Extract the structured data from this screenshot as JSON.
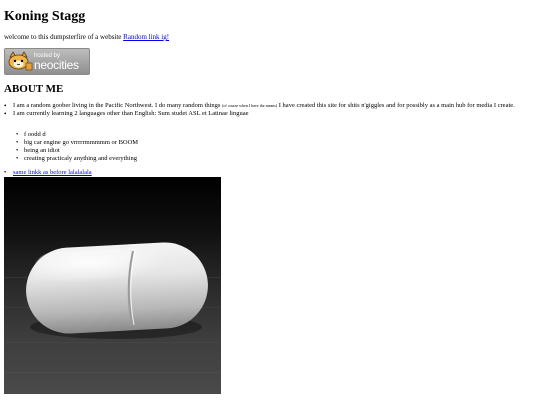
{
  "header": {
    "title": "Koning Stagg"
  },
  "intro": {
    "text": "welcome to this dumpsterfire of a website ",
    "link": "Random link ig!"
  },
  "badge": {
    "hosted_by": "hosted by",
    "brand": "neocities"
  },
  "about": {
    "heading": "ABOUT ME",
    "items": [
      {
        "before": "I am a random goober living in the Pacific Northwest. I do many random things ",
        "small": "(of course when I have the means)",
        "after": " I have created this site for shits n'giggles and for possibly as a main hub for media I create."
      },
      {
        "text": "I am currently learning 2 languages other than English: Sum studet ASL et Latinae linguae"
      }
    ],
    "sub_items": [
      "f oodd d",
      "big car engine go vrrrrrmmmmm or BOOM",
      "being an idiot",
      "creating practicaly anything and everything"
    ]
  },
  "same_link": "same linkk as before lalalalala",
  "image": {
    "subject": "white-capsule-pill-image"
  }
}
